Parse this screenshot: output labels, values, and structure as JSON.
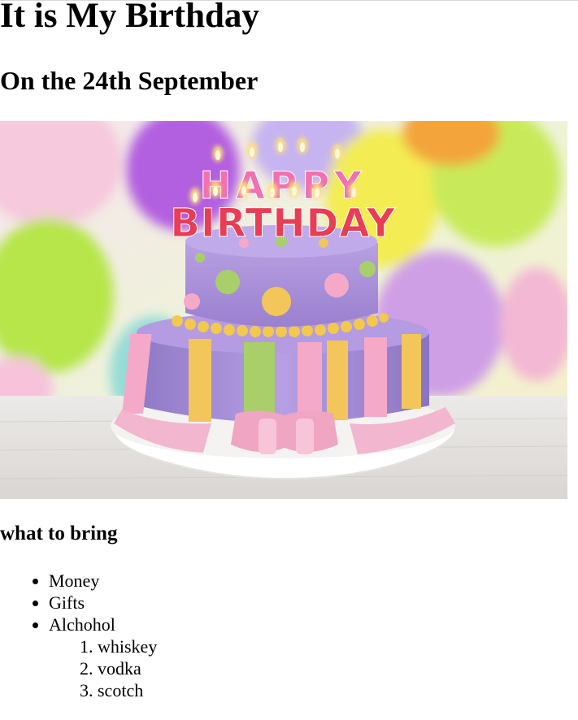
{
  "heading": "It is My Birthday",
  "subheading": "On the 24th September",
  "image": {
    "icon": "birthday-cake-photo",
    "cake_letters_top": "HAPPY",
    "cake_letters_bottom": "BIRTHDAY"
  },
  "bring_title": "what to bring",
  "items": [
    "Money",
    "Gifts",
    "Alchohol"
  ],
  "drinks": [
    "whiskey",
    "vodka",
    "scotch"
  ],
  "colors": {
    "cake_purple": "#a98ed6",
    "ribbon_pink": "#f3b6cf",
    "stripe_yellow": "#f2c65a",
    "stripe_green": "#a8cf6a"
  }
}
